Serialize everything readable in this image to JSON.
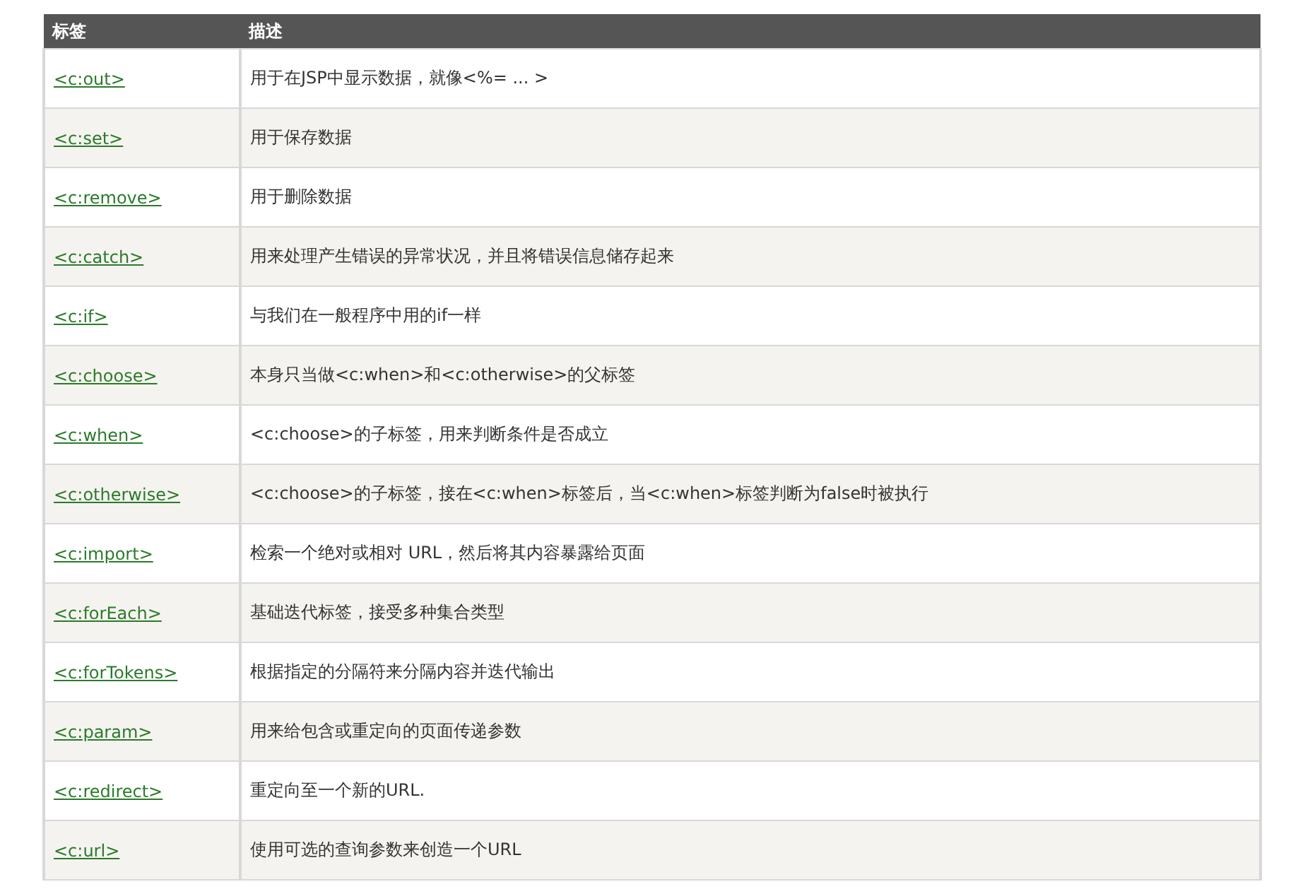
{
  "table": {
    "columns": [
      "标签",
      "描述"
    ],
    "rows": [
      {
        "tag": "<c:out>",
        "description": "用于在JSP中显示数据，就像<%= ... >"
      },
      {
        "tag": "<c:set>",
        "description": "用于保存数据"
      },
      {
        "tag": "<c:remove>",
        "description": "用于删除数据"
      },
      {
        "tag": "<c:catch>",
        "description": "用来处理产生错误的异常状况，并且将错误信息储存起来"
      },
      {
        "tag": "<c:if>",
        "description": "与我们在一般程序中用的if一样"
      },
      {
        "tag": "<c:choose>",
        "description": "本身只当做<c:when>和<c:otherwise>的父标签"
      },
      {
        "tag": "<c:when>",
        "description": "<c:choose>的子标签，用来判断条件是否成立"
      },
      {
        "tag": "<c:otherwise>",
        "description": "<c:choose>的子标签，接在<c:when>标签后，当<c:when>标签判断为false时被执行"
      },
      {
        "tag": "<c:import>",
        "description": "检索一个绝对或相对 URL，然后将其内容暴露给页面"
      },
      {
        "tag": "<c:forEach>",
        "description": "基础迭代标签，接受多种集合类型"
      },
      {
        "tag": "<c:forTokens>",
        "description": "根据指定的分隔符来分隔内容并迭代输出"
      },
      {
        "tag": "<c:param>",
        "description": "用来给包含或重定向的页面传递参数"
      },
      {
        "tag": "<c:redirect>",
        "description": "重定向至一个新的URL."
      },
      {
        "tag": "<c:url>",
        "description": "使用可选的查询参数来创造一个URL"
      }
    ]
  }
}
